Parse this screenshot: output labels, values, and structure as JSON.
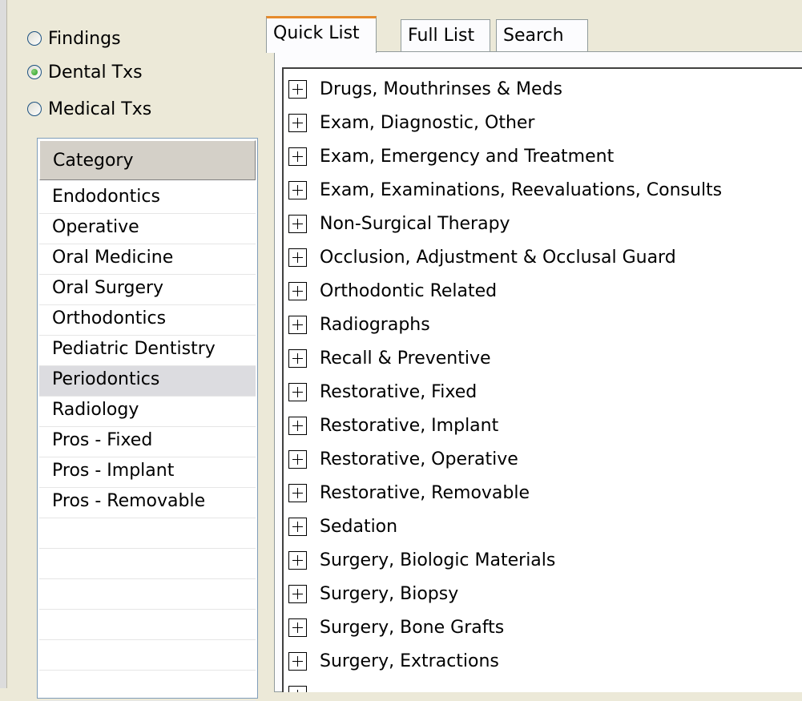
{
  "mode_options": [
    {
      "label": "Findings",
      "checked": false
    },
    {
      "label": "Dental Txs",
      "checked": true
    },
    {
      "label": "Medical Txs",
      "checked": false
    }
  ],
  "category_list": {
    "header": "Category",
    "items": [
      "Endodontics",
      "Operative",
      "Oral Medicine",
      "Oral Surgery",
      "Orthodontics",
      "Pediatric Dentistry",
      "Periodontics",
      "Radiology",
      "Pros - Fixed",
      "Pros - Implant",
      "Pros - Removable"
    ],
    "selected": "Periodontics"
  },
  "tabs": [
    {
      "label": "Quick List",
      "active": true
    },
    {
      "label": "Full List",
      "active": false
    },
    {
      "label": "Search",
      "active": false
    }
  ],
  "tree_items": [
    "Drugs, Mouthrinses & Meds",
    "Exam, Diagnostic, Other",
    "Exam, Emergency and Treatment",
    "Exam, Examinations, Reevaluations, Consults",
    "Non-Surgical Therapy",
    "Occlusion, Adjustment & Occlusal Guard",
    "Orthodontic Related",
    "Radiographs",
    "Recall & Preventive",
    "Restorative, Fixed",
    "Restorative, Implant",
    "Restorative, Operative",
    "Restorative, Removable",
    "Sedation",
    "Surgery, Biologic Materials",
    "Surgery, Biopsy",
    "Surgery, Bone Grafts",
    "Surgery, Extractions"
  ]
}
